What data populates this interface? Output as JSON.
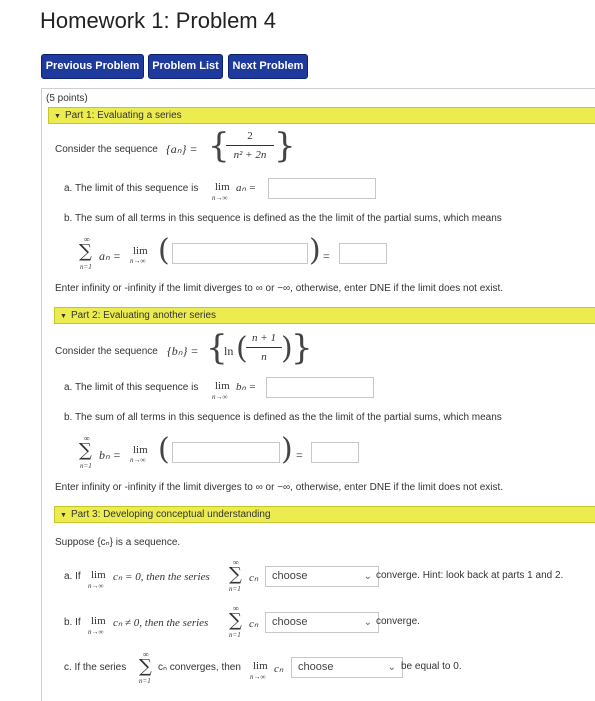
{
  "page": {
    "title": "Homework 1: Problem 4"
  },
  "nav": {
    "previous": "Previous Problem",
    "list": "Problem List",
    "next": "Next Problem"
  },
  "points": "(5 points)",
  "part1": {
    "header": "Part 1: Evaluating a series",
    "consider": "Consider the sequence",
    "seq_lhs": "{aₙ} =",
    "seq_num": "2",
    "seq_den": "n² + 2n",
    "a_text": "a. The limit of this sequence is",
    "lim": "lim",
    "limsub": "n→∞",
    "a_var": "aₙ =",
    "b_text": "b. The sum of all terms in this sequence is defined as the the limit of the partial sums, which means",
    "sum_top": "∞",
    "sum_var": "aₙ =",
    "sum_bot": "n=1",
    "note": "Enter infinity or -infinity if the limit diverges to ∞ or −∞, otherwise, enter DNE if the limit does not exist."
  },
  "part2": {
    "header": "Part 2: Evaluating another series",
    "consider": "Consider the sequence",
    "seq_lhs": "{bₙ} =",
    "seq_ln": "ln",
    "seq_num": "n + 1",
    "seq_den": "n",
    "a_text": "a. The limit of this sequence is",
    "lim": "lim",
    "limsub": "n→∞",
    "a_var": "bₙ =",
    "b_text": "b. The sum of all terms in this sequence is defined as the the limit of the partial sums, which means",
    "sum_top": "∞",
    "sum_var": "bₙ =",
    "sum_bot": "n=1",
    "note": "Enter infinity or -infinity if the limit diverges to ∞ or −∞, otherwise, enter DNE if the limit does not exist."
  },
  "part3": {
    "header": "Part 3: Developing conceptual understanding",
    "suppose": "Suppose {cₙ} is a sequence.",
    "qa_prefix": "a. If",
    "qa_cond": "cₙ = 0, then the series",
    "qa_select": "choose",
    "qa_suffix": "converge. Hint: look back at parts 1 and 2.",
    "qb_prefix": "b. If",
    "qb_cond": "cₙ ≠ 0, then the series",
    "qb_select": "choose",
    "qb_suffix": "converge.",
    "qc_prefix": "c. If the series",
    "qc_mid": "cₙ converges, then",
    "qc_lim_var": "cₙ",
    "qc_select": "choose",
    "qc_suffix": "be equal to 0.",
    "lim": "lim",
    "limsub": "n→∞",
    "sum_top": "∞",
    "sum_bot": "n=1",
    "sum_var": "cₙ"
  }
}
